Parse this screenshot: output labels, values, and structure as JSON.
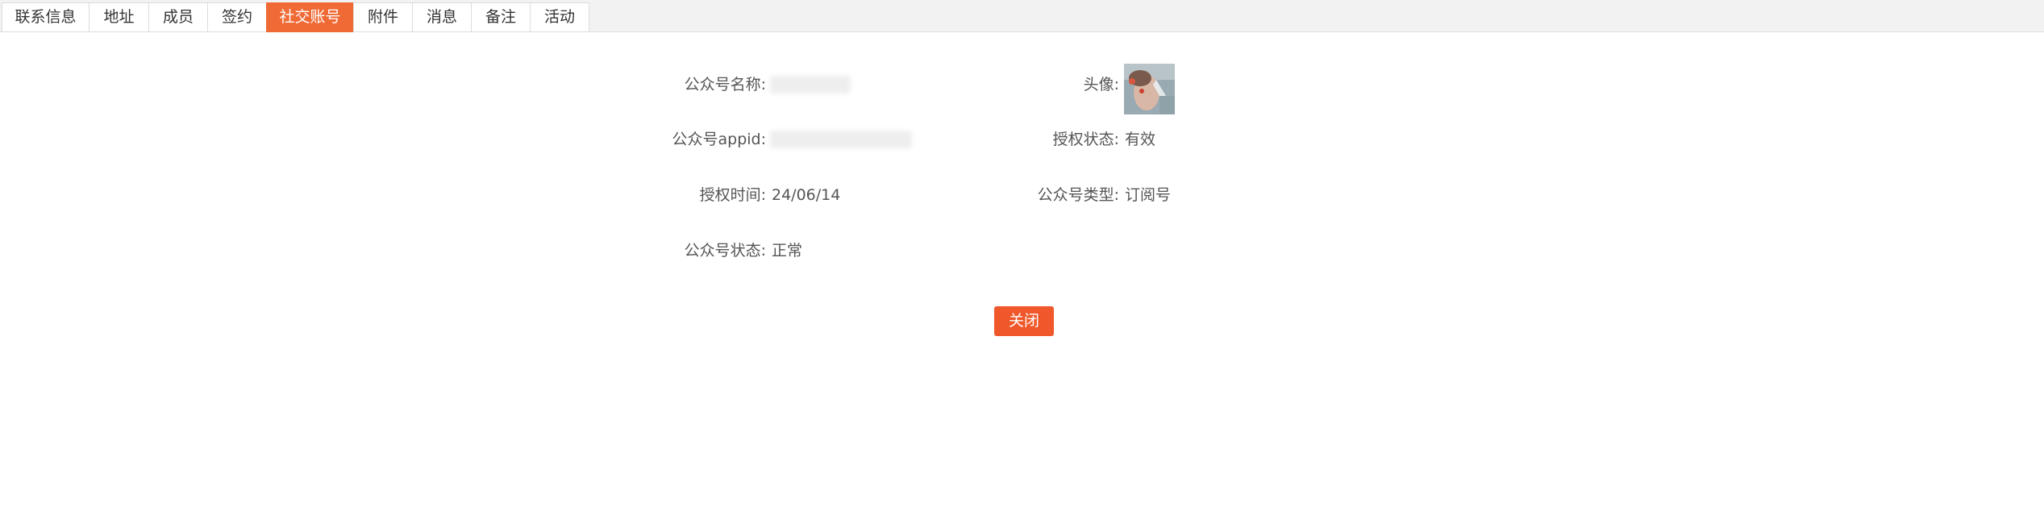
{
  "tabs": [
    {
      "label": "联系信息",
      "active": false
    },
    {
      "label": "地址",
      "active": false
    },
    {
      "label": "成员",
      "active": false
    },
    {
      "label": "签约",
      "active": false
    },
    {
      "label": "社交账号",
      "active": true
    },
    {
      "label": "附件",
      "active": false
    },
    {
      "label": "消息",
      "active": false
    },
    {
      "label": "备注",
      "active": false
    },
    {
      "label": "活动",
      "active": false
    }
  ],
  "details": {
    "account_name_label": "公众号名称:",
    "account_name_value": "",
    "avatar_label": "头像:",
    "appid_label": "公众号appid:",
    "appid_value": "",
    "auth_status_label": "授权状态:",
    "auth_status_value": "有效",
    "auth_time_label": "授权时间:",
    "auth_time_value": "24/06/14",
    "account_type_label": "公众号类型:",
    "account_type_value": "订阅号",
    "account_status_label": "公众号状态:",
    "account_status_value": "正常"
  },
  "actions": {
    "close_label": "关闭"
  },
  "colors": {
    "accent": "#f06a35",
    "button": "#f0572a",
    "text": "#555555",
    "tabbar_bg": "#f2f2f2"
  }
}
